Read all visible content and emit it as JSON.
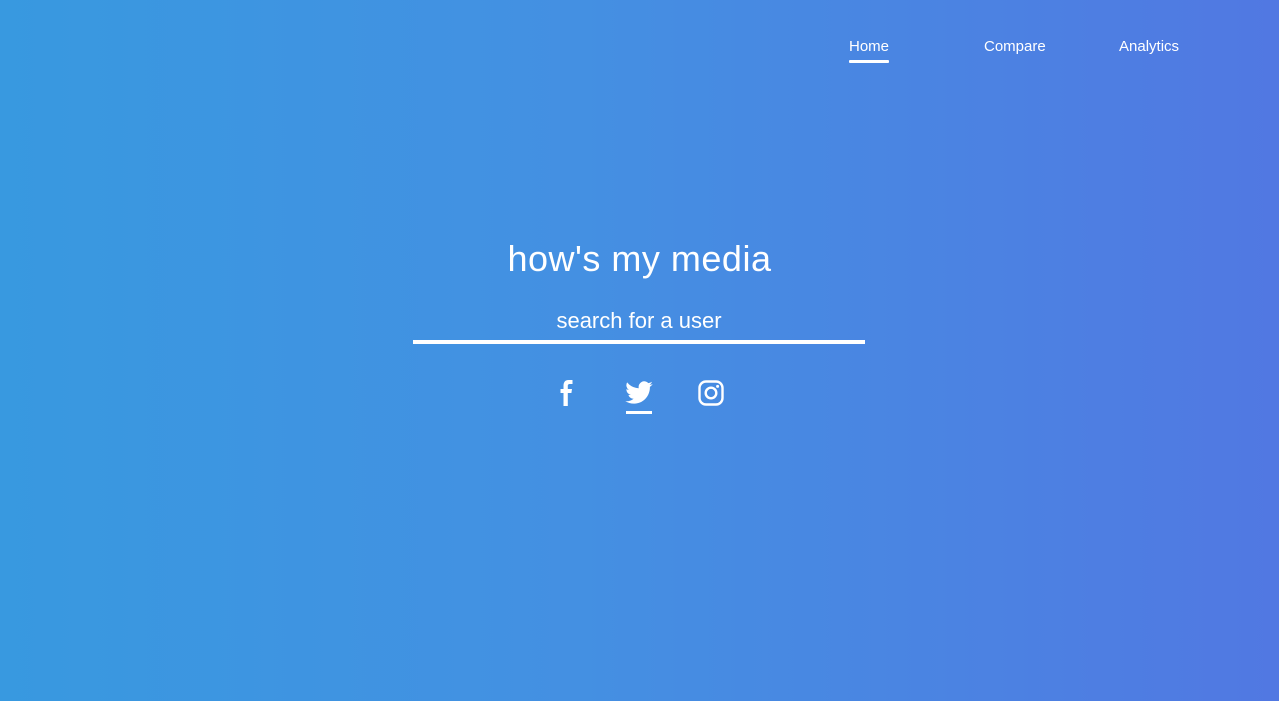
{
  "nav": {
    "items": [
      {
        "label": "Home",
        "active": true
      },
      {
        "label": "Compare",
        "active": false
      },
      {
        "label": "Analytics",
        "active": false
      }
    ]
  },
  "hero": {
    "title": "how's my media"
  },
  "search": {
    "placeholder": "search for a user",
    "value": ""
  },
  "platforms": {
    "icons": [
      {
        "name": "facebook-icon",
        "selected": false
      },
      {
        "name": "twitter-icon",
        "selected": true
      },
      {
        "name": "instagram-icon",
        "selected": false
      }
    ]
  },
  "colors": {
    "gradient_start": "#3899e0",
    "gradient_end": "#5178e2",
    "foreground": "#ffffff"
  }
}
